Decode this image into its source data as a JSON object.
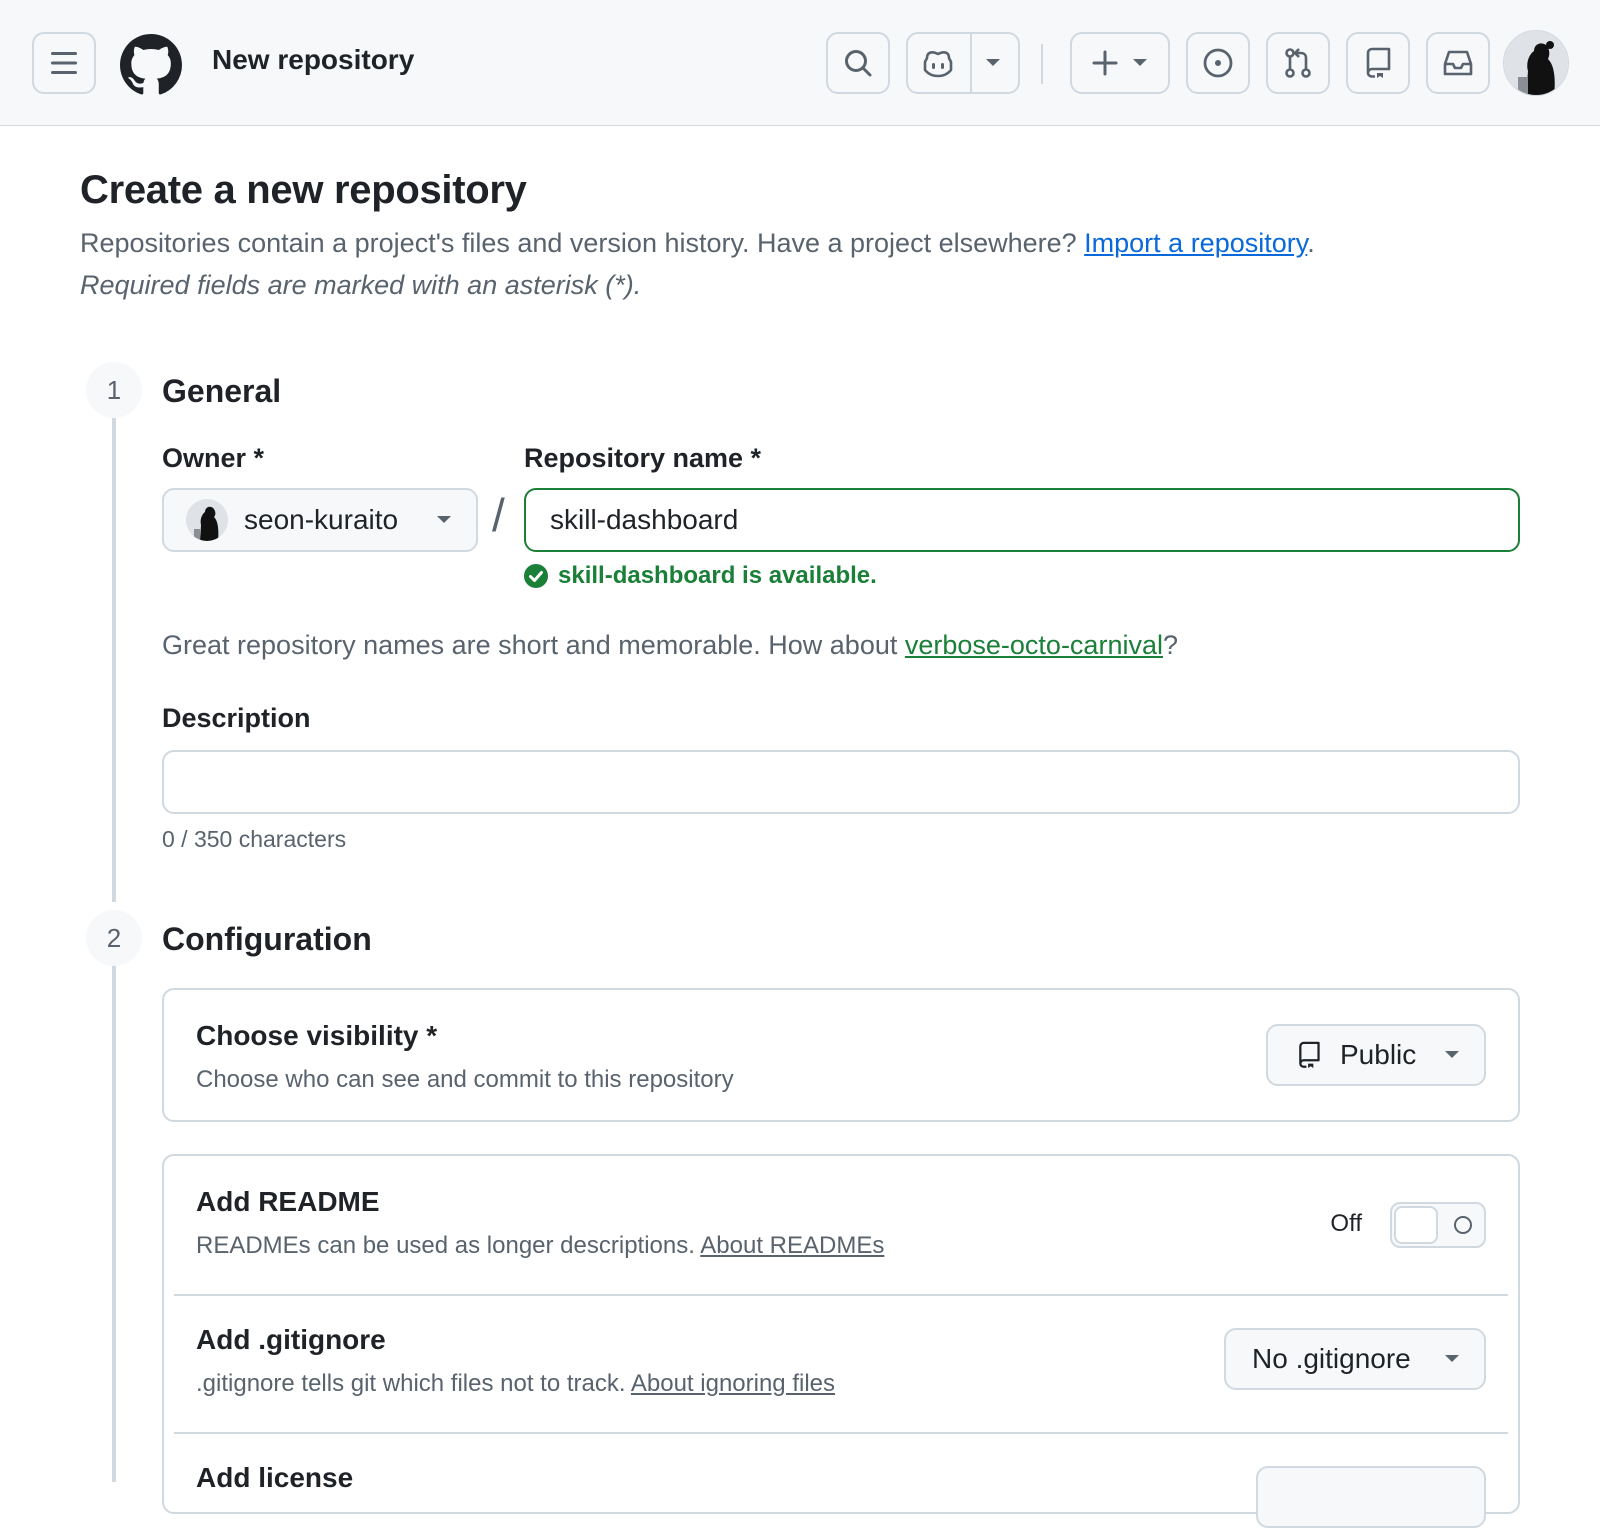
{
  "header": {
    "page_context": "New repository",
    "icons": [
      "hamburger-icon",
      "github-logo-icon",
      "search-icon",
      "copilot-icon",
      "chevron-down-icon",
      "plus-icon",
      "issue-icon",
      "pull-request-icon",
      "repo-icon",
      "inbox-icon",
      "avatar"
    ]
  },
  "intro": {
    "title": "Create a new repository",
    "text": "Repositories contain a project's files and version history. Have a project elsewhere? ",
    "import_link": "Import a repository",
    "text_end": ".",
    "required_note": "Required fields are marked with an asterisk (*)."
  },
  "general": {
    "step_number": "1",
    "title": "General",
    "owner_label": "Owner *",
    "owner_value": "seon-kuraito",
    "separator": "/",
    "repo_name_label": "Repository name *",
    "repo_name_value": "skill-dashboard",
    "availability": "skill-dashboard is available.",
    "suggestion_text": "Great repository names are short and memorable. How about ",
    "suggestion_link": "verbose-octo-carnival",
    "suggestion_end": "?",
    "description_label": "Description",
    "description_value": "",
    "description_counter": "0 / 350 characters"
  },
  "configuration": {
    "step_number": "2",
    "title": "Configuration",
    "visibility": {
      "title": "Choose visibility *",
      "description": "Choose who can see and commit to this repository",
      "selected": "Public"
    },
    "readme": {
      "title": "Add README",
      "description": "READMEs can be used as longer descriptions. ",
      "link": "About READMEs",
      "toggle_state": "Off"
    },
    "gitignore": {
      "title": "Add .gitignore",
      "description": ".gitignore tells git which files not to track. ",
      "link": "About ignoring files",
      "selected": "No .gitignore"
    },
    "license": {
      "title": "Add license"
    }
  },
  "colors": {
    "accent_link": "#0969da",
    "success": "#1a7f37",
    "muted_text": "#59636e",
    "border": "#d1d9e0"
  }
}
